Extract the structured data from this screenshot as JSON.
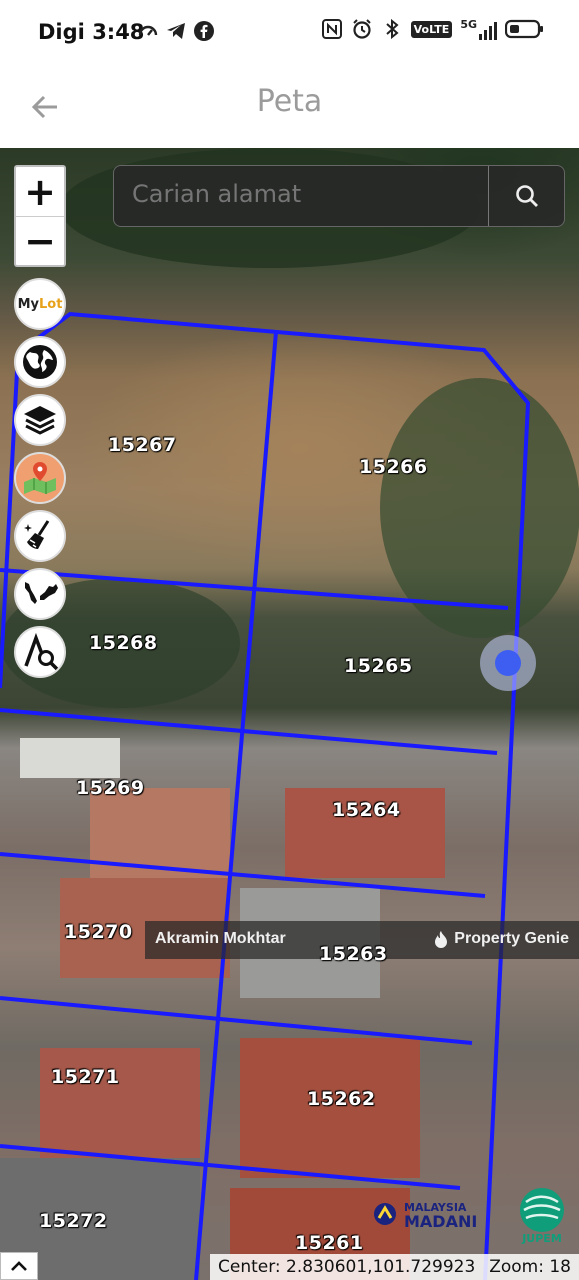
{
  "status_bar": {
    "carrier": "Digi",
    "time": "3:48",
    "left_icons": [
      "speedometer-icon",
      "telegram-icon",
      "facebook-icon"
    ],
    "right_icons": [
      "nfc-icon",
      "alarm-icon",
      "bluetooth-icon",
      "volte-icon",
      "5g-signal-icon",
      "battery-icon"
    ],
    "volte_label": "VoLTE",
    "network_label": "5G"
  },
  "app_bar": {
    "title": "Peta",
    "back_icon": "arrow-left-icon"
  },
  "map": {
    "search": {
      "placeholder": "Carian alamat",
      "icon": "search-icon"
    },
    "zoom_in_label": "+",
    "zoom_out_label": "−",
    "tools": [
      {
        "name": "mylot",
        "label": "MyLot"
      },
      {
        "name": "globe"
      },
      {
        "name": "layers"
      },
      {
        "name": "map-pin"
      },
      {
        "name": "clear"
      },
      {
        "name": "malaysia-map"
      },
      {
        "name": "measure-search"
      }
    ],
    "plots": [
      "15267",
      "15266",
      "15268",
      "15265",
      "15269",
      "15264",
      "15270",
      "15263",
      "15271",
      "15262",
      "15272",
      "15261"
    ],
    "watermark": {
      "name": "Akramin Mokhtar",
      "brand": "Property Genie"
    },
    "madani_logo": {
      "line1": "MALAYSIA",
      "line2": "MADANI"
    },
    "jupem_logo": {
      "text": "JUPEM"
    },
    "collapse_icon": "chevron-up-icon",
    "center_text": "Center: 2.830601,101.729923",
    "zoom_text": "Zoom: 18",
    "colors": {
      "parcel_line": "#1a1aff",
      "location_dot": "#3d5ef0"
    }
  }
}
